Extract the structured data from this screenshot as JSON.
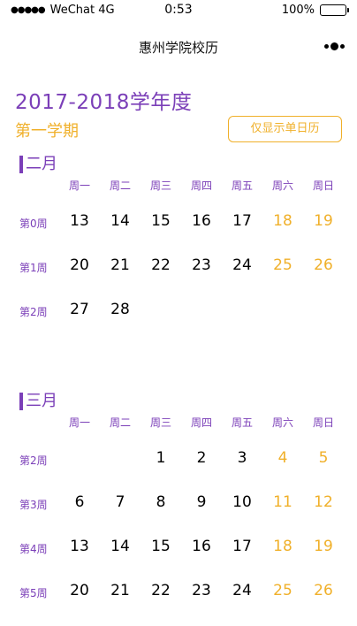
{
  "status_bar": {
    "carrier": "WeChat 4G",
    "time": "0:53",
    "battery_percent": "100%",
    "battery_level": 1.0
  },
  "nav": {
    "title": "惠州学院校历"
  },
  "header": {
    "year": "2017-2018学年度",
    "semester": "第一学期",
    "toggle_label": "仅显示单日历"
  },
  "weekdays": [
    "周一",
    "周二",
    "周三",
    "周四",
    "周五",
    "周六",
    "周日"
  ],
  "months": [
    {
      "title": "二月",
      "weeks": [
        {
          "label": "第0周",
          "days": [
            "13",
            "14",
            "15",
            "16",
            "17",
            "18",
            "19"
          ]
        },
        {
          "label": "第1周",
          "days": [
            "20",
            "21",
            "22",
            "23",
            "24",
            "25",
            "26"
          ]
        },
        {
          "label": "第2周",
          "days": [
            "27",
            "28",
            "",
            "",
            "",
            "",
            ""
          ]
        }
      ]
    },
    {
      "title": "三月",
      "weeks": [
        {
          "label": "第2周",
          "days": [
            "",
            "",
            "1",
            "2",
            "3",
            "4",
            "5"
          ]
        },
        {
          "label": "第3周",
          "days": [
            "6",
            "7",
            "8",
            "9",
            "10",
            "11",
            "12"
          ]
        },
        {
          "label": "第4周",
          "days": [
            "13",
            "14",
            "15",
            "16",
            "17",
            "18",
            "19"
          ]
        },
        {
          "label": "第5周",
          "days": [
            "20",
            "21",
            "22",
            "23",
            "24",
            "25",
            "26"
          ]
        }
      ]
    }
  ],
  "colors": {
    "purple": "#7b3fb8",
    "orange": "#f0b02a"
  }
}
